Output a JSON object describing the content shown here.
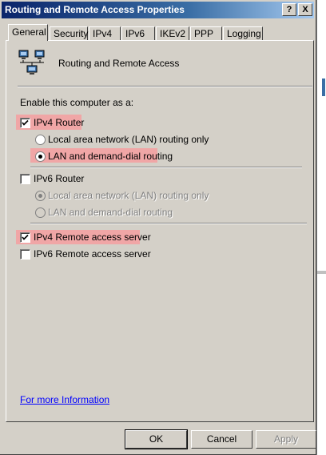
{
  "window": {
    "title": "Routing and Remote Access Properties",
    "help_label": "?",
    "close_label": "X"
  },
  "tabs": [
    {
      "label": "General",
      "active": true
    },
    {
      "label": "Security",
      "active": false
    },
    {
      "label": "IPv4",
      "active": false
    },
    {
      "label": "IPv6",
      "active": false
    },
    {
      "label": "IKEv2",
      "active": false
    },
    {
      "label": "PPP",
      "active": false
    },
    {
      "label": "Logging",
      "active": false
    }
  ],
  "general": {
    "service_name": "Routing and Remote Access",
    "enable_label": "Enable this computer as a:",
    "ipv4_router": {
      "label": "IPv4 Router",
      "checked": true
    },
    "ipv4_lan_only": {
      "label": "Local area network (LAN) routing only",
      "selected": false
    },
    "ipv4_demand_dial": {
      "label": "LAN and demand-dial routing",
      "selected": true
    },
    "ipv6_router": {
      "label": "IPv6 Router",
      "checked": false
    },
    "ipv6_lan_only": {
      "label": "Local area network (LAN) routing only",
      "selected": true,
      "disabled": true
    },
    "ipv6_demand_dial": {
      "label": "LAN and demand-dial routing",
      "selected": false,
      "disabled": true
    },
    "ipv4_remote_access": {
      "label": "IPv4 Remote access server",
      "checked": true
    },
    "ipv6_remote_access": {
      "label": "IPv6 Remote access server",
      "checked": false
    },
    "more_info_link": "For more Information"
  },
  "buttons": {
    "ok": "OK",
    "cancel": "Cancel",
    "apply": "Apply"
  },
  "colors": {
    "titlebar_start": "#0a246a",
    "titlebar_end": "#a6caf0",
    "highlight": "#f0a6a6",
    "link": "#0000ff",
    "face": "#d4d0c8"
  }
}
